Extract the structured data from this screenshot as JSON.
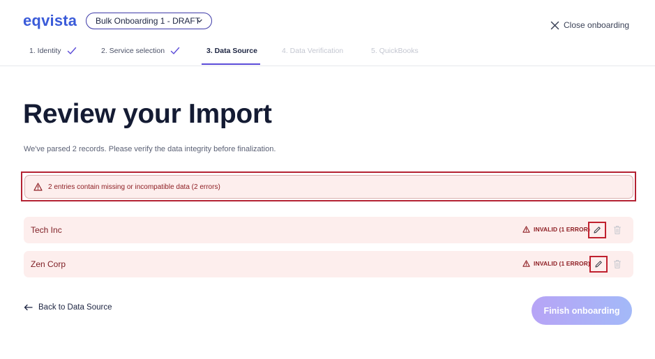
{
  "header": {
    "logo_text": "eqvista",
    "draft_select": {
      "value": "Bulk Onboarding 1 - DRAFT",
      "icon": "chevron-down-icon"
    },
    "close_label": "Close onboarding"
  },
  "steps": [
    {
      "label": "1. Identity",
      "state": "done"
    },
    {
      "label": "2. Service selection",
      "state": "done"
    },
    {
      "label": "3. Data Source",
      "state": "active"
    },
    {
      "label": "4. Data Verification",
      "state": "disabled"
    },
    {
      "label": "5. QuickBooks",
      "state": "disabled"
    }
  ],
  "main": {
    "title": "Review your Import",
    "subtitle": "We've parsed 2 records. Please verify the data integrity before finalization.",
    "alert_text": "2 entries contain missing or incompatible data (2 errors)",
    "records": [
      {
        "name": "Tech Inc",
        "status": "INVALID (1 ERROR)"
      },
      {
        "name": "Zen Corp",
        "status": "INVALID (1 ERROR)"
      }
    ]
  },
  "footer": {
    "back_label": "Back to Data Source",
    "finish_label": "Finish onboarding"
  },
  "colors": {
    "brand": "#3a5bd9",
    "accent": "#5b4bd8",
    "error_text": "#8e1f24",
    "error_bg": "#fdeeed",
    "highlight_outline": "#b42232"
  }
}
